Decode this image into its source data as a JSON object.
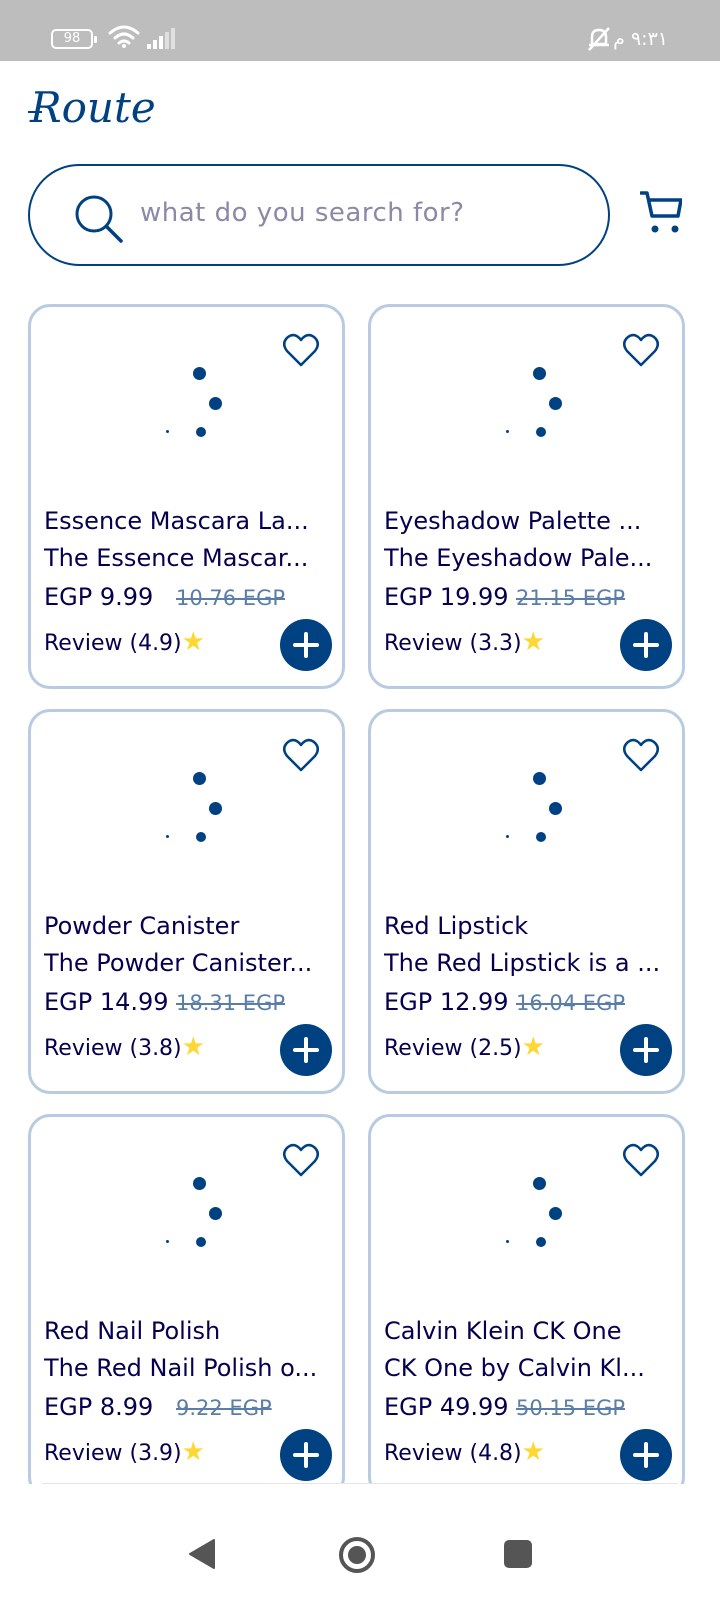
{
  "status": {
    "battery": "98",
    "time": "٩:٣١ م"
  },
  "header": {
    "logo": "Route"
  },
  "search": {
    "placeholder": "what do you search for?"
  },
  "currency_prefix": "EGP",
  "products": [
    {
      "title": "Essence Mascara La...",
      "description": "The Essence Mascar...",
      "price": "EGP 9.99",
      "old_price": "10.76 EGP",
      "review": "Review (4.9)"
    },
    {
      "title": "Eyeshadow Palette ...",
      "description": "The Eyeshadow Pale...",
      "price": "EGP 19.99",
      "old_price": "21.15 EGP",
      "review": "Review (3.3)"
    },
    {
      "title": "Powder Canister",
      "description": "The Powder Canister...",
      "price": "EGP 14.99",
      "old_price": "18.31 EGP",
      "review": "Review (3.8)"
    },
    {
      "title": "Red Lipstick",
      "description": "The Red Lipstick is a ...",
      "price": "EGP 12.99",
      "old_price": "16.04 EGP",
      "review": "Review (2.5)"
    },
    {
      "title": "Red Nail Polish",
      "description": "The Red Nail Polish o...",
      "price": "EGP 8.99",
      "old_price": "9.22 EGP",
      "review": "Review (3.9)"
    },
    {
      "title": "Calvin Klein CK One",
      "description": "CK One by Calvin Kl...",
      "price": "EGP 49.99",
      "old_price": "50.15 EGP",
      "review": "Review (4.8)"
    }
  ],
  "colors": {
    "primary": "#004182",
    "text": "#06004f",
    "card_border": "#b8cbe0",
    "star": "#fdd835",
    "old_price": "#5a7ea7"
  },
  "icons": {
    "search": "search-icon",
    "cart": "cart-icon",
    "favorite": "heart-outline-icon",
    "add": "plus-circle-icon",
    "star": "star-icon"
  }
}
